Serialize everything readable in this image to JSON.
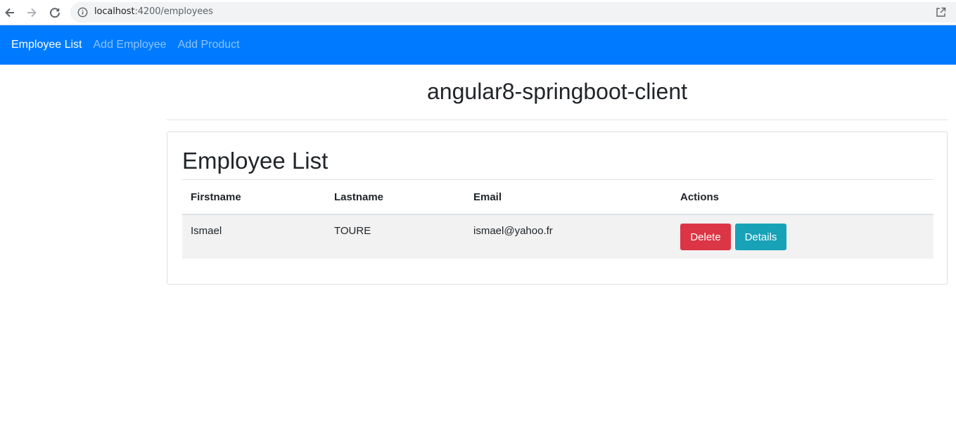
{
  "browser": {
    "url_host": "localhost",
    "url_path": ":4200/employees",
    "back_icon": "arrow-left-icon",
    "forward_icon": "arrow-right-icon",
    "reload_icon": "reload-icon",
    "info_icon": "info-icon",
    "open_tab_icon": "open-in-new-icon"
  },
  "navbar": {
    "items": [
      {
        "label": "Employee List",
        "active": true
      },
      {
        "label": "Add Employee",
        "active": false
      },
      {
        "label": "Add Product",
        "active": false
      }
    ],
    "color": "#007bff"
  },
  "app_title": "angular8-springboot-client",
  "panel": {
    "heading": "Employee List",
    "table": {
      "headers": [
        "Firstname",
        "Lastname",
        "Email",
        "Actions"
      ],
      "rows": [
        {
          "firstname": "Ismael",
          "lastname": "TOURE",
          "email": "ismael@yahoo.fr",
          "delete_label": "Delete",
          "details_label": "Details"
        }
      ]
    }
  },
  "colors": {
    "danger": "#dc3545",
    "info": "#17a2b8"
  }
}
